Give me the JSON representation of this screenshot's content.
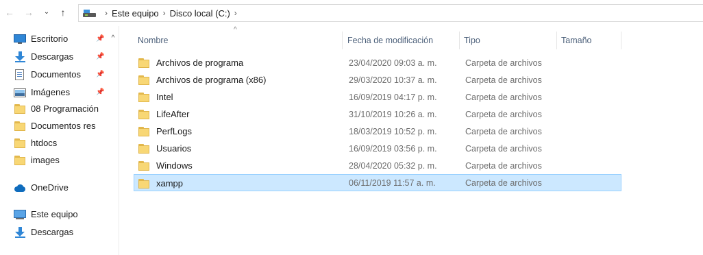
{
  "address": {
    "breadcrumb": [
      "Este equipo",
      "Disco local (C:)"
    ],
    "separator": "›"
  },
  "sidebar": {
    "items": [
      {
        "label": "Escritorio",
        "icon": "desktop-icon",
        "pinned": true
      },
      {
        "label": "Descargas",
        "icon": "download-arrow-icon",
        "pinned": true
      },
      {
        "label": "Documentos",
        "icon": "document-icon",
        "pinned": true
      },
      {
        "label": "Imágenes",
        "icon": "pictures-icon",
        "pinned": true
      },
      {
        "label": "08 Programación",
        "icon": "folder-icon",
        "pinned": false
      },
      {
        "label": "Documentos res",
        "icon": "folder-icon",
        "pinned": false
      },
      {
        "label": "htdocs",
        "icon": "folder-icon",
        "pinned": false
      },
      {
        "label": "images",
        "icon": "folder-icon",
        "pinned": false
      },
      {
        "label": "OneDrive",
        "icon": "onedrive-cloud-icon",
        "pinned": false
      },
      {
        "label": "Este equipo",
        "icon": "computer-icon",
        "pinned": false
      },
      {
        "label": "Descargas",
        "icon": "download-arrow-icon",
        "pinned": false
      }
    ]
  },
  "list": {
    "columns": {
      "name": "Nombre",
      "date": "Fecha de modificación",
      "type": "Tipo",
      "size": "Tamaño"
    },
    "rows": [
      {
        "name": "Archivos de programa",
        "date": "23/04/2020 09:03 a. m.",
        "type": "Carpeta de archivos",
        "size": ""
      },
      {
        "name": "Archivos de programa (x86)",
        "date": "29/03/2020 10:37 a. m.",
        "type": "Carpeta de archivos",
        "size": ""
      },
      {
        "name": "Intel",
        "date": "16/09/2019 04:17 p. m.",
        "type": "Carpeta de archivos",
        "size": ""
      },
      {
        "name": "LifeAfter",
        "date": "31/10/2019 10:26 a. m.",
        "type": "Carpeta de archivos",
        "size": ""
      },
      {
        "name": "PerfLogs",
        "date": "18/03/2019 10:52 p. m.",
        "type": "Carpeta de archivos",
        "size": ""
      },
      {
        "name": "Usuarios",
        "date": "16/09/2019 03:56 p. m.",
        "type": "Carpeta de archivos",
        "size": ""
      },
      {
        "name": "Windows",
        "date": "28/04/2020 05:32 p. m.",
        "type": "Carpeta de archivos",
        "size": ""
      },
      {
        "name": "xampp",
        "date": "06/11/2019 11:57 a. m.",
        "type": "Carpeta de archivos",
        "size": "",
        "selected": true
      }
    ]
  },
  "colors": {
    "selection_bg": "#cce8ff",
    "selection_border": "#99d1ff",
    "folder": "#f8d775",
    "header_text": "#4c607a"
  }
}
